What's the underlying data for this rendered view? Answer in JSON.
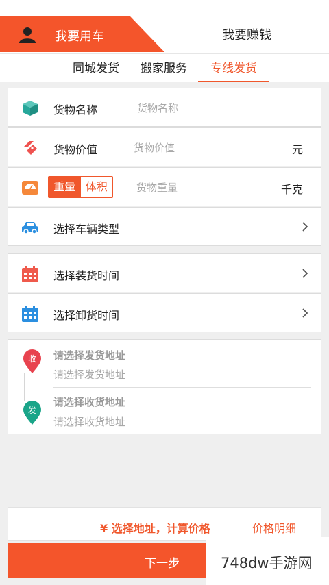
{
  "mode_tabs": {
    "active_label": "我要用车",
    "other_label": "我要赚钱"
  },
  "sub_tabs": [
    {
      "label": "同城发货",
      "active": false
    },
    {
      "label": "搬家服务",
      "active": false
    },
    {
      "label": "专线发货",
      "active": true
    }
  ],
  "form": {
    "goods_name": {
      "label": "货物名称",
      "placeholder": "货物名称"
    },
    "goods_value": {
      "label": "货物价值",
      "placeholder": "货物价值",
      "unit": "元"
    },
    "goods_weight": {
      "seg_weight": "重量",
      "seg_volume": "体积",
      "placeholder": "货物重量",
      "unit": "千克"
    },
    "vehicle_type": {
      "label": "选择车辆类型"
    },
    "load_time": {
      "label": "选择装货时间"
    },
    "unload_time": {
      "label": "选择卸货时间"
    }
  },
  "address": {
    "pickup_pin": "收",
    "pickup_title": "请选择发货地址",
    "pickup_placeholder": "请选择发货地址",
    "delivery_pin": "发",
    "delivery_title": "请选择收货地址",
    "delivery_placeholder": "请选择收货地址"
  },
  "price": {
    "currency_symbol": "¥",
    "tip": "选择地址，计算价格",
    "detail_link": "价格明细"
  },
  "next_button": "下一步",
  "watermark": "748dw手游网",
  "colors": {
    "accent": "#f0572c",
    "pin_pickup": "#e8434f",
    "pin_delivery": "#1aa589",
    "box_icon": "#26a79a",
    "tag_icon": "#ef5350",
    "scale_icon": "#f5883a",
    "car_icon": "#2b8fe0",
    "cal_load": "#ef5a4c",
    "cal_unload": "#2b8fe0"
  },
  "icons": [
    "user-icon",
    "box-icon",
    "price-tag-icon",
    "scale-icon",
    "car-icon",
    "calendar-icon",
    "chevron-right-icon",
    "location-pin-icon"
  ]
}
